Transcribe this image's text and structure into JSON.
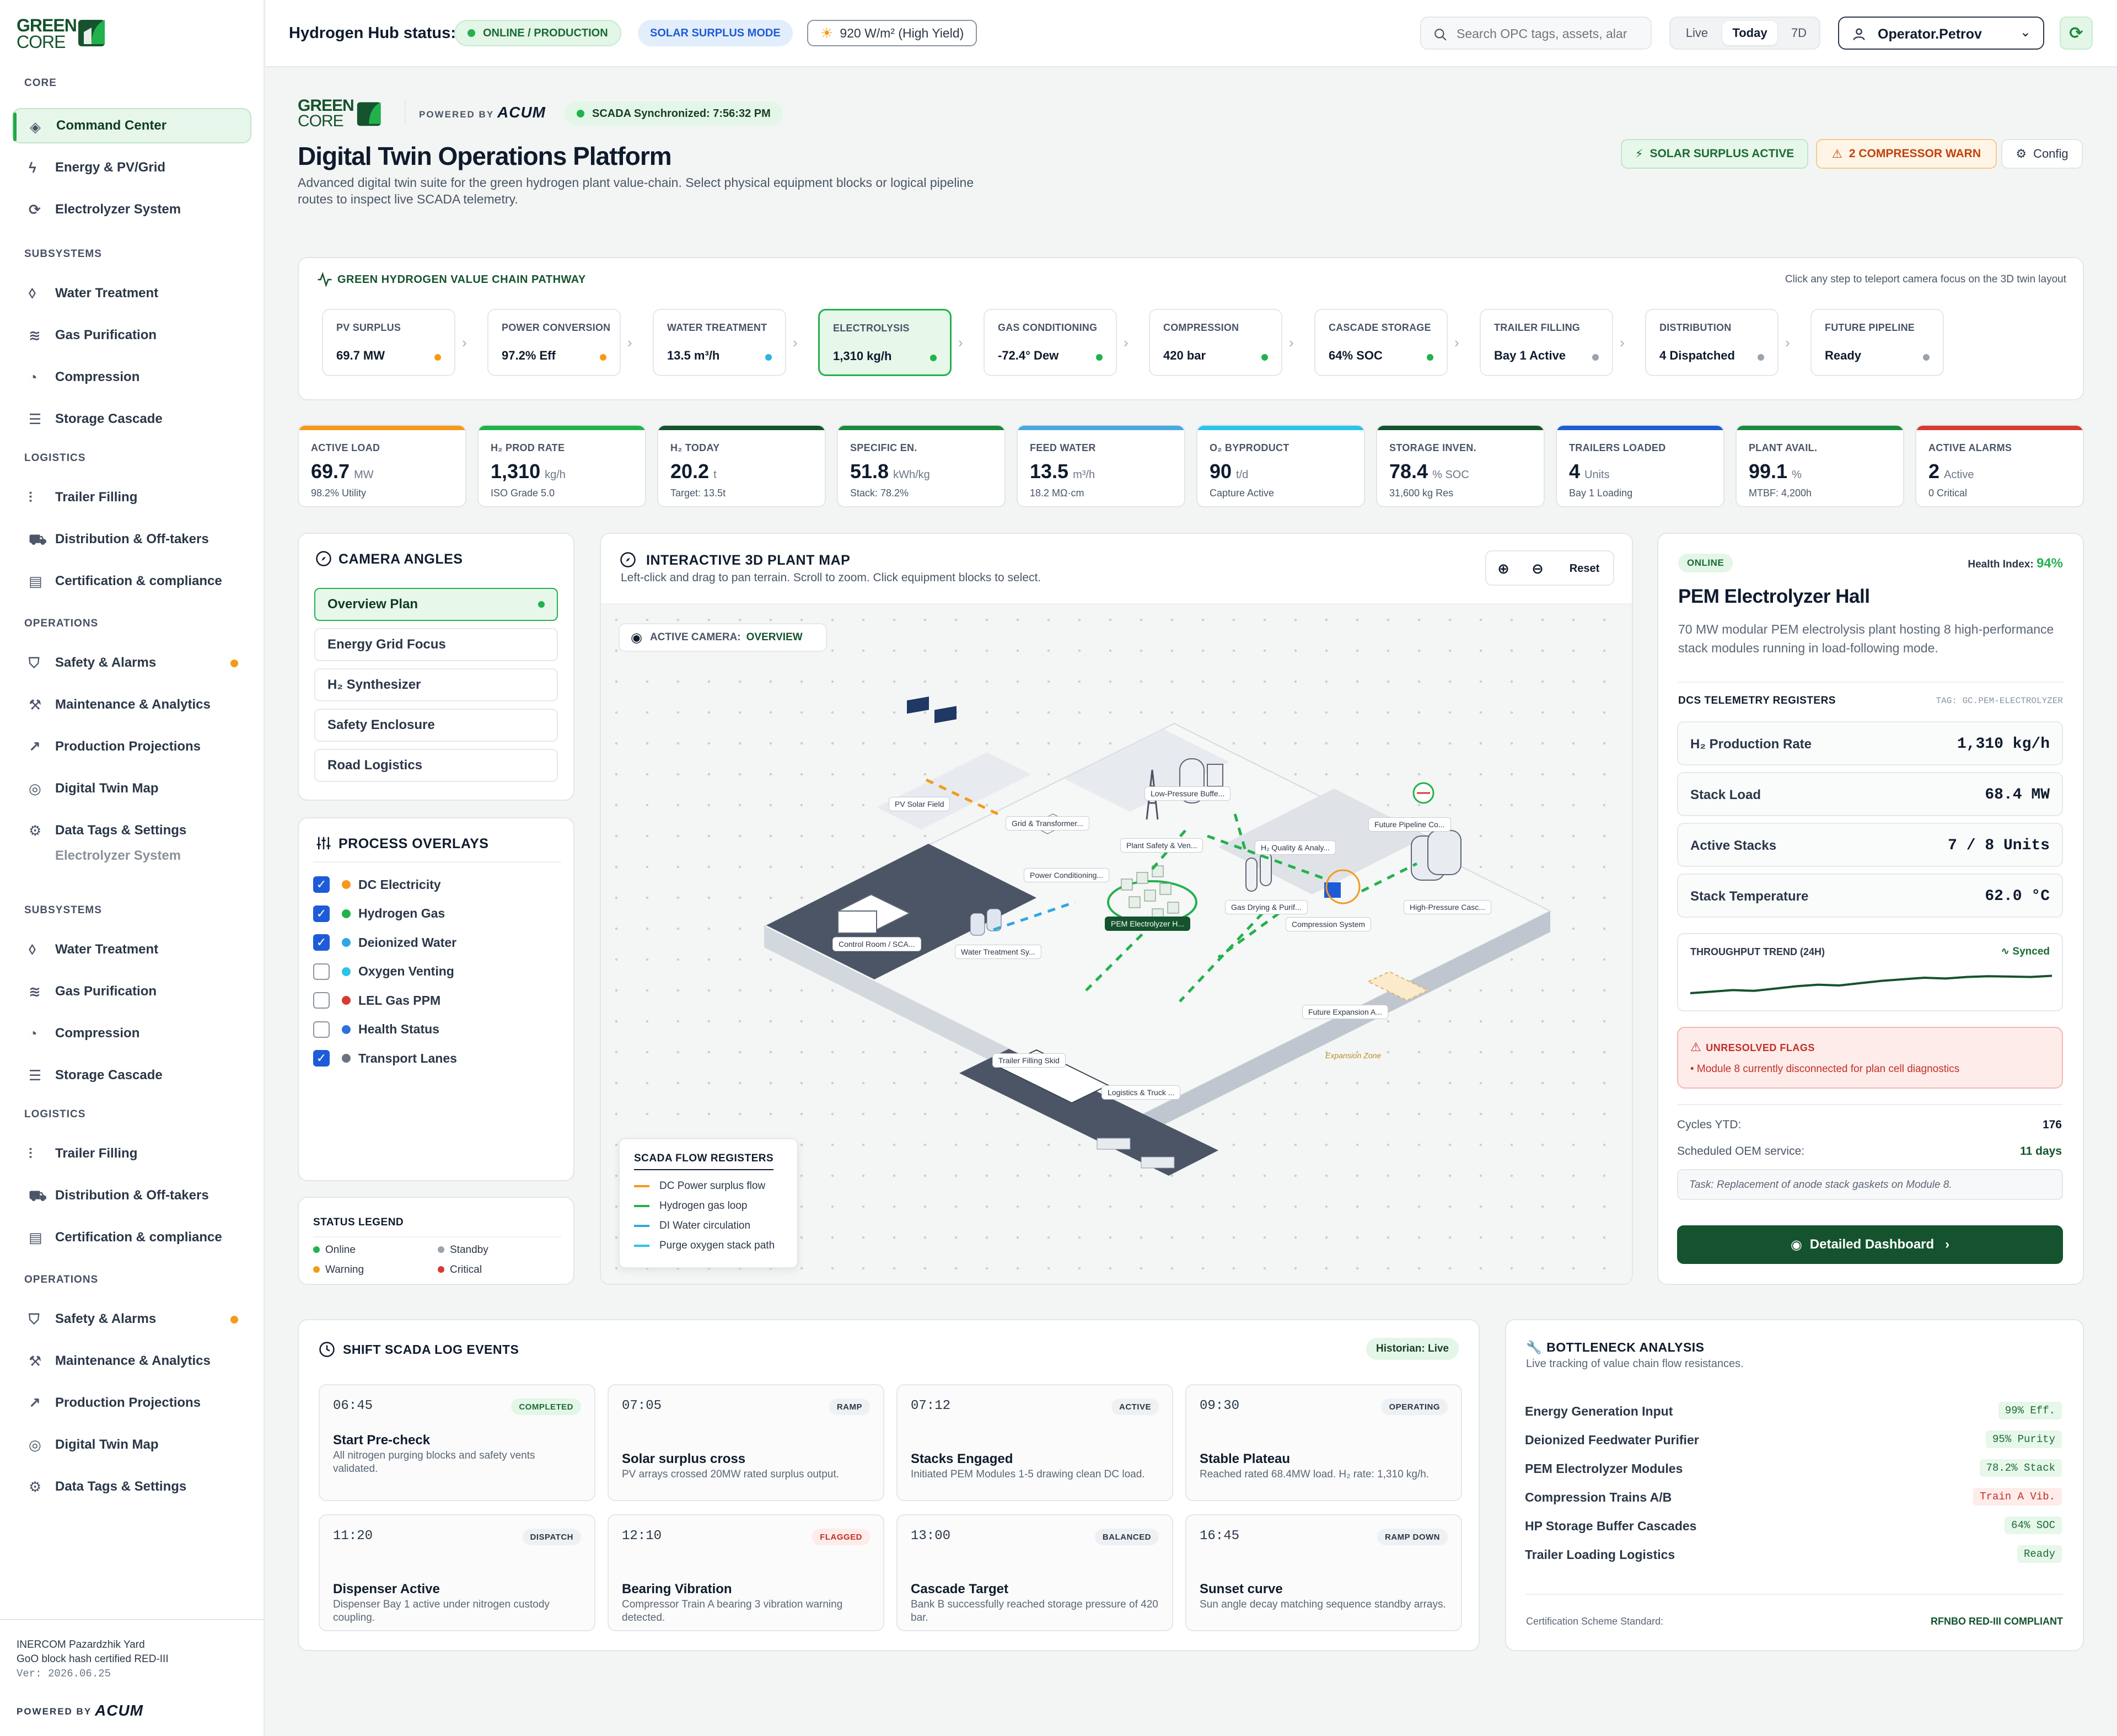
{
  "brand": {
    "logo_top": "GREEN",
    "logo_bottom": "CORE",
    "powered_by": "POWERED BY",
    "partner": "ACUM"
  },
  "sidebar": {
    "sections": [
      {
        "title": "CORE",
        "items": [
          {
            "label": "Command Center",
            "icon": "layers-icon",
            "active": true
          },
          {
            "label": "Energy & PV/Grid",
            "icon": "bolt-icon"
          },
          {
            "label": "Electrolyzer System",
            "icon": "refresh-icon"
          }
        ]
      },
      {
        "title": "SUBSYSTEMS",
        "items": [
          {
            "label": "Water Treatment",
            "icon": "droplet-icon"
          },
          {
            "label": "Gas Purification",
            "icon": "wind-icon"
          },
          {
            "label": "Compression",
            "icon": "gauge-icon"
          },
          {
            "label": "Storage Cascade",
            "icon": "database-icon"
          }
        ]
      },
      {
        "title": "LOGISTICS",
        "items": [
          {
            "label": "Trailer Filling",
            "icon": "sliders-icon"
          },
          {
            "label": "Distribution & Off-takers",
            "icon": "truck-icon"
          },
          {
            "label": "Certification & compliance",
            "icon": "document-icon"
          }
        ]
      },
      {
        "title": "OPERATIONS",
        "items": [
          {
            "label": "Safety & Alarms",
            "icon": "shield-icon",
            "alert": true
          },
          {
            "label": "Maintenance & Analytics",
            "icon": "wrench-icon"
          },
          {
            "label": "Production Projections",
            "icon": "trend-icon"
          },
          {
            "label": "Digital Twin Map",
            "icon": "compass-icon"
          },
          {
            "label": "Data Tags & Settings",
            "icon": "gear-icon"
          }
        ]
      }
    ],
    "ghost_item": "Electrolyzer System",
    "footer": {
      "site": "INERCOM Pazardzhik Yard",
      "cert": "GoO block hash certified RED-III",
      "ver": "Ver: 2026.06.25",
      "powered_by": "POWERED BY",
      "partner": "ACUM"
    }
  },
  "topbar": {
    "status_label": "Hydrogen Hub status:",
    "online": "ONLINE / PRODUCTION",
    "mode": "SOLAR SURPLUS MODE",
    "irradiance": "920 W/m² (High Yield)",
    "search_placeholder": "Search OPC tags, assets, alar",
    "range": [
      "Live",
      "Today",
      "7D"
    ],
    "range_selected": "Today",
    "operator": "Operator.Petrov"
  },
  "header": {
    "scada_sync": "SCADA Synchronized: 7:56:32 PM",
    "title": "Digital Twin Operations Platform",
    "description": "Advanced digital twin suite for the green hydrogen plant value-chain. Select physical equipment blocks or logical pipeline routes to inspect live SCADA telemetry.",
    "solar_badge": "SOLAR SURPLUS ACTIVE",
    "warn_badge": "2 COMPRESSOR WARN",
    "config": "Config"
  },
  "pathway": {
    "title": "GREEN HYDROGEN VALUE CHAIN PATHWAY",
    "hint": "Click any step to teleport camera focus on the 3D twin layout",
    "steps": [
      {
        "label": "PV SURPLUS",
        "value": "69.7 MW",
        "color": "#f49a1a"
      },
      {
        "label": "POWER CONVERSION",
        "value": "97.2% Eff",
        "color": "#f49a1a"
      },
      {
        "label": "WATER TREATMENT",
        "value": "13.5 m³/h",
        "color": "#2fb3e0"
      },
      {
        "label": "ELECTROLYSIS",
        "value": "1,310 kg/h",
        "color": "#22b24c",
        "active": true
      },
      {
        "label": "GAS CONDITIONING",
        "value": "-72.4° Dew",
        "color": "#22b24c"
      },
      {
        "label": "COMPRESSION",
        "value": "420 bar",
        "color": "#22b24c"
      },
      {
        "label": "CASCADE STORAGE",
        "value": "64% SOC",
        "color": "#22b24c"
      },
      {
        "label": "TRAILER FILLING",
        "value": "Bay 1 Active",
        "color": "#9aa3ae"
      },
      {
        "label": "DISTRIBUTION",
        "value": "4 Dispatched",
        "color": "#9aa3ae"
      },
      {
        "label": "FUTURE PIPELINE",
        "value": "Ready",
        "color": "#9aa3ae"
      }
    ]
  },
  "kpis": [
    {
      "label": "ACTIVE LOAD",
      "value": "69.7",
      "unit": "MW",
      "sub": "98.2% Utility",
      "color": "#f49a1a"
    },
    {
      "label": "H₂ PROD RATE",
      "value": "1,310",
      "unit": "kg/h",
      "sub": "ISO Grade 5.0",
      "color": "#22b24c"
    },
    {
      "label": "H₂ TODAY",
      "value": "20.2",
      "unit": "t",
      "sub": "Target: 13.5t",
      "color": "#14532d"
    },
    {
      "label": "SPECIFIC EN.",
      "value": "51.8",
      "unit": "kWh/kg",
      "sub": "Stack: 78.2%",
      "color": "#1a8a3c"
    },
    {
      "label": "FEED WATER",
      "value": "13.5",
      "unit": "m³/h",
      "sub": "18.2 MΩ·cm",
      "color": "#47a9e0"
    },
    {
      "label": "O₂ BYPRODUCT",
      "value": "90",
      "unit": "t/d",
      "sub": "Capture Active",
      "color": "#29c4e8"
    },
    {
      "label": "STORAGE INVEN.",
      "value": "78.4",
      "unit": "% SOC",
      "sub": "31,600 kg Res",
      "color": "#14532d"
    },
    {
      "label": "TRAILERS LOADED",
      "value": "4",
      "unit": "Units",
      "sub": "Bay 1 Loading",
      "color": "#1e5bd7"
    },
    {
      "label": "PLANT AVAIL.",
      "value": "99.1",
      "unit": "%",
      "sub": "MTBF: 4,200h",
      "color": "#1a8a3c"
    },
    {
      "label": "ACTIVE ALARMS",
      "value": "2",
      "unit": "Active",
      "sub": "0 Critical",
      "color": "#d63b32"
    }
  ],
  "camera": {
    "title": "CAMERA ANGLES",
    "items": [
      "Overview Plan",
      "Energy Grid Focus",
      "H₂ Synthesizer",
      "Safety Enclosure",
      "Road Logistics"
    ],
    "selected": "Overview Plan"
  },
  "overlays": {
    "title": "PROCESS OVERLAYS",
    "items": [
      {
        "label": "DC Electricity",
        "checked": true,
        "color": "#f49a1a"
      },
      {
        "label": "Hydrogen Gas",
        "checked": true,
        "color": "#22b24c"
      },
      {
        "label": "Deionized Water",
        "checked": true,
        "color": "#2fa7e0"
      },
      {
        "label": "Oxygen Venting",
        "checked": false,
        "color": "#29c4e8"
      },
      {
        "label": "LEL Gas PPM",
        "checked": false,
        "color": "#d63b32"
      },
      {
        "label": "Health Status",
        "checked": false,
        "color": "#2f6fde"
      },
      {
        "label": "Transport Lanes",
        "checked": true,
        "color": "#6b7280"
      }
    ]
  },
  "status_legend": {
    "title": "STATUS LEGEND",
    "online": "Online",
    "standby": "Standby",
    "warning": "Warning",
    "critical": "Critical"
  },
  "map": {
    "title": "INTERACTIVE 3D PLANT MAP",
    "hint": "Left-click and drag to pan terrain. Scroll to zoom. Click equipment blocks to select.",
    "reset": "Reset",
    "active_camera_label": "ACTIVE CAMERA:",
    "active_camera_value": "OVERVIEW",
    "labels": [
      "PV Solar Field",
      "Grid & Transformer...",
      "Low-Pressure Buffe...",
      "Future Pipeline Co...",
      "Plant Safety & Ven...",
      "H₂ Quality & Analy...",
      "Power Conditioning...",
      "Gas Drying & Purif...",
      "High-Pressure Casc...",
      "PEM Electrolyzer H...",
      "Compression System",
      "Control Room / SCA...",
      "Water Treatment Sy...",
      "Future Expansion A...",
      "Trailer Filling Skid",
      "Logistics & Truck ...",
      "Expansion Zone"
    ],
    "registers_title": "SCADA FLOW REGISTERS",
    "registers": [
      {
        "label": "DC Power surplus flow",
        "color": "#f49a1a"
      },
      {
        "label": "Hydrogen gas loop",
        "color": "#22b24c"
      },
      {
        "label": "DI Water circulation",
        "color": "#2fa7e0"
      },
      {
        "label": "Purge oxygen stack path",
        "color": "#29c4e8"
      }
    ]
  },
  "asset": {
    "status": "ONLINE",
    "health_label": "Health Index:",
    "health_value": "94%",
    "name": "PEM Electrolyzer Hall",
    "description": "70 MW modular PEM electrolysis plant hosting 8 high-performance stack modules running in load-following mode.",
    "registers_title": "DCS TELEMETRY REGISTERS",
    "tag": "TAG: GC.PEM-ELECTROLYZER",
    "registers": [
      {
        "label": "H₂ Production Rate",
        "value": "1,310 kg/h"
      },
      {
        "label": "Stack Load",
        "value": "68.4 MW"
      },
      {
        "label": "Active Stacks",
        "value": "7 / 8 Units"
      },
      {
        "label": "Stack Temperature",
        "value": "62.0 °C"
      }
    ],
    "trend_title": "THROUGHPUT TREND (24H)",
    "trend_status": "Synced",
    "trend": [
      0.3,
      0.34,
      0.38,
      0.36,
      0.42,
      0.48,
      0.52,
      0.5,
      0.56,
      0.62,
      0.66,
      0.7,
      0.68,
      0.72,
      0.74,
      0.73,
      0.72,
      0.75
    ],
    "flags_title": "UNRESOLVED FLAGS",
    "flag": "• Module 8 currently disconnected for plan cell diagnostics",
    "cycles_label": "Cycles YTD:",
    "cycles_value": "176",
    "oem_label": "Scheduled OEM service:",
    "oem_value": "11 days",
    "task": "Task: Replacement of anode stack gaskets on Module 8.",
    "dashboard_button": "Detailed Dashboard"
  },
  "log": {
    "title": "SHIFT SCADA LOG EVENTS",
    "historian": "Historian: Live",
    "events": [
      {
        "time": "06:45",
        "badge": "COMPLETED",
        "tone": "green",
        "title": "Start Pre-check",
        "desc": "All nitrogen purging blocks and safety vents validated."
      },
      {
        "time": "07:05",
        "badge": "RAMP",
        "tone": "grey",
        "title": "Solar surplus cross",
        "desc": "PV arrays crossed 20MW rated surplus output."
      },
      {
        "time": "07:12",
        "badge": "ACTIVE",
        "tone": "grey",
        "title": "Stacks Engaged",
        "desc": "Initiated PEM Modules 1-5 drawing clean DC load."
      },
      {
        "time": "09:30",
        "badge": "OPERATING",
        "tone": "grey",
        "title": "Stable Plateau",
        "desc": "Reached rated 68.4MW load. H₂ rate: 1,310 kg/h."
      },
      {
        "time": "11:20",
        "badge": "DISPATCH",
        "tone": "grey",
        "title": "Dispenser Active",
        "desc": "Dispenser Bay 1 active under nitrogen custody coupling."
      },
      {
        "time": "12:10",
        "badge": "FLAGGED",
        "tone": "red",
        "title": "Bearing Vibration",
        "desc": "Compressor Train A bearing 3 vibration warning detected."
      },
      {
        "time": "13:00",
        "badge": "BALANCED",
        "tone": "grey",
        "title": "Cascade Target",
        "desc": "Bank B successfully reached storage pressure of 420 bar."
      },
      {
        "time": "16:45",
        "badge": "RAMP DOWN",
        "tone": "grey",
        "title": "Sunset curve",
        "desc": "Sun angle decay matching sequence standby arrays."
      }
    ]
  },
  "bottleneck": {
    "title": "BOTTLENECK ANALYSIS",
    "subtitle": "Live tracking of value chain flow resistances.",
    "rows": [
      {
        "label": "Energy Generation Input",
        "value": "99% Eff.",
        "tone": "green"
      },
      {
        "label": "Deionized Feedwater Purifier",
        "value": "95% Purity",
        "tone": "green"
      },
      {
        "label": "PEM Electrolyzer Modules",
        "value": "78.2% Stack",
        "tone": "green"
      },
      {
        "label": "Compression Trains A/B",
        "value": "Train A Vib.",
        "tone": "red"
      },
      {
        "label": "HP Storage Buffer Cascades",
        "value": "64% SOC",
        "tone": "green"
      },
      {
        "label": "Trailer Loading Logistics",
        "value": "Ready",
        "tone": "green"
      }
    ],
    "cert_label": "Certification Scheme Standard:",
    "cert_value": "RFNBO RED-III COMPLIANT"
  },
  "colors": {
    "primary": "#14532d",
    "accent": "#22b24c",
    "warn": "#f49a1a",
    "danger": "#d63b32"
  }
}
